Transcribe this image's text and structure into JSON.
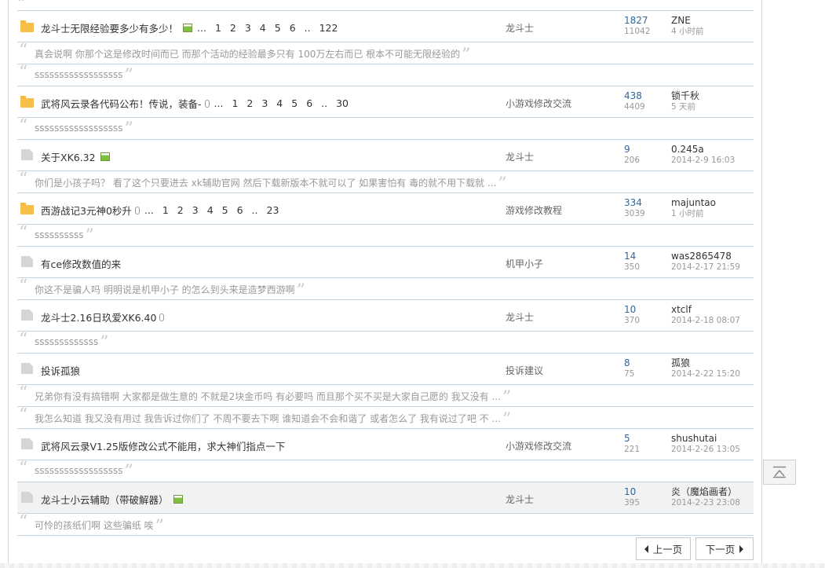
{
  "threads": [
    {
      "title": "龙斗士无限经验要多少有多少！",
      "icon": "hot",
      "image": true,
      "attach": false,
      "pages": [
        "...",
        "1",
        "2",
        "3",
        "4",
        "5",
        "6",
        "..",
        "122"
      ],
      "forum": "龙斗士",
      "replies": "1827",
      "views": "11042",
      "last_user": "ZNE",
      "last_time": "4 小时前",
      "preview": "真会说啊 你那个这是修改时间而已 而那个活动的经验最多只有 100万左右而已 根本不可能无限经验的"
    },
    {
      "title": "",
      "icon": "",
      "image": false,
      "attach": false,
      "pages": [],
      "forum": "",
      "replies": "",
      "views": "",
      "last_user": "",
      "last_time": "",
      "preview": "ssssssssssssssssss",
      "preview_only": true
    },
    {
      "title": "武将风云录各代码公布！传说，装备-",
      "icon": "hot",
      "image": false,
      "attach": true,
      "pages": [
        "...",
        "1",
        "2",
        "3",
        "4",
        "5",
        "6",
        "..",
        "30"
      ],
      "forum": "小游戏修改交流",
      "replies": "438",
      "views": "4409",
      "last_user": "锁千秋",
      "last_time": "5 天前",
      "preview": "ssssssssssssssssss"
    },
    {
      "title": "关于XK6.32",
      "icon": "normal",
      "image": true,
      "attach": false,
      "pages": [],
      "forum": "龙斗士",
      "replies": "9",
      "views": "206",
      "last_user": "0.245a",
      "last_time": "2014-2-9 16:03",
      "preview": "你们是小孩子吗？ 看了这个只要进去 xk辅助官网 然后下载新版本不就可以了 如果害怕有 毒的就不用下载就 ..."
    },
    {
      "title": "西游战记3元神0秒升",
      "icon": "hot",
      "image": false,
      "attach": true,
      "pages": [
        "...",
        "1",
        "2",
        "3",
        "4",
        "5",
        "6",
        "..",
        "23"
      ],
      "forum": "游戏修改教程",
      "replies": "334",
      "views": "3039",
      "last_user": "majuntao",
      "last_time": "1 小时前",
      "preview": "ssssssssss"
    },
    {
      "title": "有ce修改数值的来",
      "icon": "normal",
      "image": false,
      "attach": false,
      "pages": [],
      "forum": "机甲小子",
      "replies": "14",
      "views": "350",
      "last_user": "was2865478",
      "last_time": "2014-2-17 21:59",
      "preview": "你这不是骗人吗 明明说是机甲小子 的怎么到头来是造梦西游啊"
    },
    {
      "title": "龙斗士2.16日玖爱XK6.40",
      "icon": "normal",
      "image": false,
      "attach": true,
      "pages": [],
      "forum": "龙斗士",
      "replies": "10",
      "views": "370",
      "last_user": "xtclf",
      "last_time": "2014-2-18 08:07",
      "preview": "sssssssssssss"
    },
    {
      "title": "投诉孤狼",
      "icon": "normal",
      "image": false,
      "attach": false,
      "pages": [],
      "forum": "投诉建议",
      "replies": "8",
      "views": "75",
      "last_user": "孤狼",
      "last_time": "2014-2-22 15:20",
      "preview": "兄弟你有没有搞错啊 大家都是做生意的 不就是2块金币吗 有必要吗 而且那个买不买是大家自己愿的 我又没有 ...",
      "preview2": "我怎么知道 我又没有用过 我告诉过你们了 不周不要去下啊 谁知道会不会和谐了 或者怎么了 我有说过了吧 不 ..."
    },
    {
      "title": "武将风云录V1.25版修改公式不能用，求大神们指点一下",
      "icon": "normal",
      "image": false,
      "attach": false,
      "pages": [],
      "forum": "小游戏修改交流",
      "replies": "5",
      "views": "221",
      "last_user": "shushutai",
      "last_time": "2014-2-26 13:05",
      "preview": "ssssssssssssssssss"
    },
    {
      "title": "龙斗士小云辅助（带破解器）",
      "icon": "normal",
      "image": true,
      "attach": false,
      "pages": [],
      "forum": "龙斗士",
      "replies": "10",
      "views": "395",
      "last_user": "炎（魔焰画者）",
      "last_time": "2014-2-23 23:08",
      "preview": "可怜的孩纸们啊 这些骗纸 唉",
      "highlight": true
    }
  ],
  "pager": {
    "prev": "上一页",
    "next": "下一页"
  }
}
